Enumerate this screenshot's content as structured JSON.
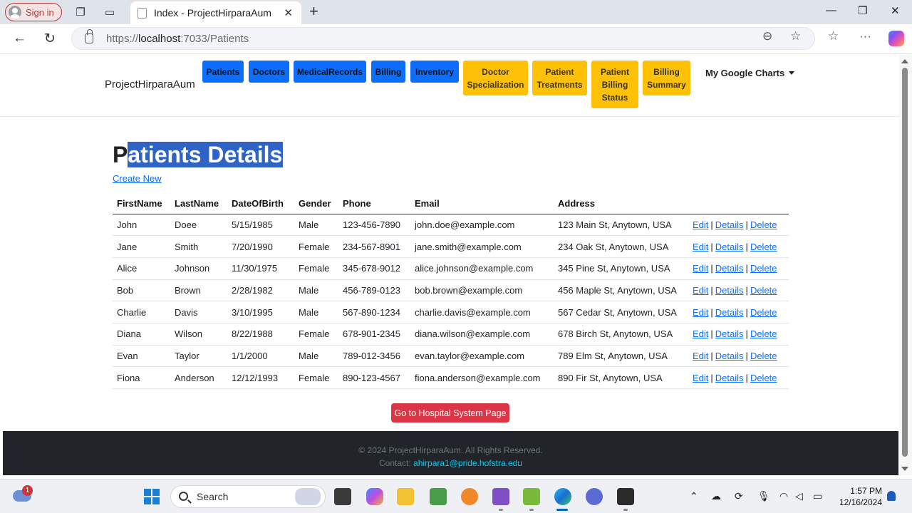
{
  "browser": {
    "signin_label": "Sign in",
    "tab_title": "Index - ProjectHirparaAum",
    "url_prefix": "https://",
    "url_host": "localhost",
    "url_path": ":7033/Patients"
  },
  "navbar": {
    "brand": "ProjectHirparaAum",
    "blue_buttons": [
      "Patients",
      "Doctors",
      "MedicalRecords",
      "Billing",
      "Inventory"
    ],
    "yellow_buttons": [
      "Doctor Specialization",
      "Patient Treatments",
      "Patient Billing Status",
      "Billing Summary"
    ],
    "charts_menu": "My Google Charts"
  },
  "page": {
    "heading_first": "P",
    "heading_rest": "atients Details",
    "create_link": "Create New",
    "hospital_button": "Go to Hospital System Page"
  },
  "table": {
    "columns": [
      "FirstName",
      "LastName",
      "DateOfBirth",
      "Gender",
      "Phone",
      "Email",
      "Address",
      ""
    ],
    "rows": [
      [
        "John",
        "Doee",
        "5/15/1985",
        "Male",
        "123-456-7890",
        "john.doe@example.com",
        "123 Main St, Anytown, USA"
      ],
      [
        "Jane",
        "Smith",
        "7/20/1990",
        "Female",
        "234-567-8901",
        "jane.smith@example.com",
        "234 Oak St, Anytown, USA"
      ],
      [
        "Alice",
        "Johnson",
        "11/30/1975",
        "Female",
        "345-678-9012",
        "alice.johnson@example.com",
        "345 Pine St, Anytown, USA"
      ],
      [
        "Bob",
        "Brown",
        "2/28/1982",
        "Male",
        "456-789-0123",
        "bob.brown@example.com",
        "456 Maple St, Anytown, USA"
      ],
      [
        "Charlie",
        "Davis",
        "3/10/1995",
        "Male",
        "567-890-1234",
        "charlie.davis@example.com",
        "567 Cedar St, Anytown, USA"
      ],
      [
        "Diana",
        "Wilson",
        "8/22/1988",
        "Female",
        "678-901-2345",
        "diana.wilson@example.com",
        "678 Birch St, Anytown, USA"
      ],
      [
        "Evan",
        "Taylor",
        "1/1/2000",
        "Male",
        "789-012-3456",
        "evan.taylor@example.com",
        "789 Elm St, Anytown, USA"
      ],
      [
        "Fiona",
        "Anderson",
        "12/12/1993",
        "Female",
        "890-123-4567",
        "fiona.anderson@example.com",
        "890 Fir St, Anytown, USA"
      ]
    ],
    "actions": [
      "Edit",
      "Details",
      "Delete"
    ],
    "separator": "|"
  },
  "footer": {
    "copyright": "© 2024 ProjectHirparaAum. All Rights Reserved.",
    "contact_label": "Contact: ",
    "contact_email": "ahirpara1@pride.hofstra.edu"
  },
  "taskbar": {
    "notification_count": "1",
    "search_placeholder": "Search",
    "time": "1:57 PM",
    "date": "12/16/2024"
  },
  "colors": {
    "primary": "#0d6efd",
    "warning": "#ffc107",
    "danger": "#dc3545",
    "footer_bg": "#212529",
    "selection": "#2f64c6"
  }
}
